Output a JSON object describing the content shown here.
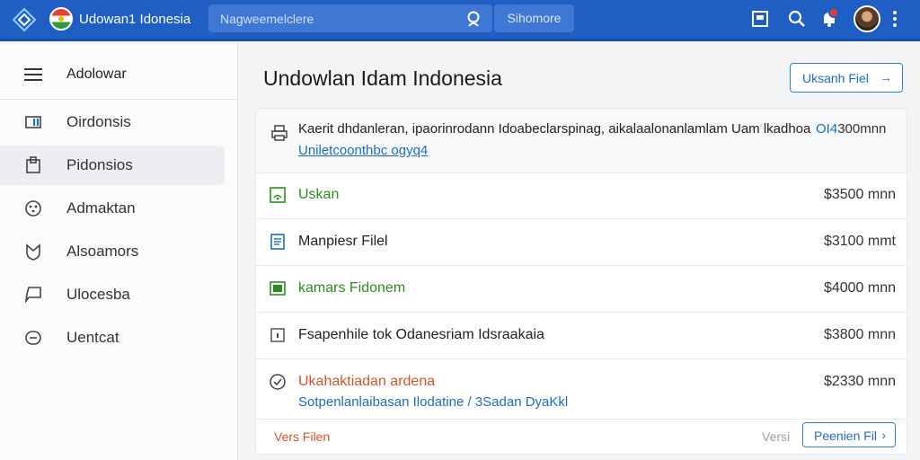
{
  "header": {
    "app_title": "Udowan1 Idonesia",
    "search_placeholder": "Nagweemelclere",
    "search_scope": "Sihomore",
    "colors": {
      "bar": "#1f5fc4",
      "notification": "#e53935"
    }
  },
  "sidebar": {
    "menu_label": "Adolowar",
    "items": [
      {
        "label": "Oirdonsis",
        "icon": "tag-icon",
        "active": false
      },
      {
        "label": "Pidonsios",
        "icon": "clipboard-icon",
        "active": true
      },
      {
        "label": "Admaktan",
        "icon": "globe-icon",
        "active": false
      },
      {
        "label": "Alsoamors",
        "icon": "shield-icon",
        "active": false
      },
      {
        "label": "Ulocesba",
        "icon": "chat-icon",
        "active": false
      },
      {
        "label": "Uentcat",
        "icon": "message-icon",
        "active": false
      }
    ]
  },
  "main": {
    "title": "Undowlan Idam Indonesia",
    "upload_button": "Uksanh Fiel",
    "notice": {
      "text": "Kaerit dhdanleran, ipaorinrodann Idoabeclarspinag, aikalaalonanlamlam Uam lkadhoa",
      "price_highlight": "OI4",
      "price_rest": "300mnn",
      "link": "Uniletcoonthbc ogyq4"
    },
    "rows": [
      {
        "label": "Uskan",
        "price": "$3500 mnn",
        "color": "#2e8b24",
        "icon": "wifi-icon"
      },
      {
        "label": "Manpiesr Filel",
        "price": "$3100 mmt",
        "color": "#222222",
        "icon": "document-icon"
      },
      {
        "label": "kamars Fidonem",
        "price": "$4000 mnn",
        "color": "#2e8b24",
        "icon": "folder-icon"
      },
      {
        "label": "Fsapenhile tok Odanesriam Idsraakaia",
        "price": "$3800 mnn",
        "color": "#222222",
        "icon": "file-icon"
      },
      {
        "label": "Ukahaktiadan ardena",
        "price": "$2330 mnn",
        "color": "#d2562a",
        "icon": "check-circle-icon",
        "sub": "Sotpenlanlaibasan Ilodatine / 3Sadan DyaKkl"
      }
    ],
    "footer": {
      "left_link": "Vers Filen",
      "right_label": "Versi",
      "button": "Peenien Fil"
    }
  }
}
